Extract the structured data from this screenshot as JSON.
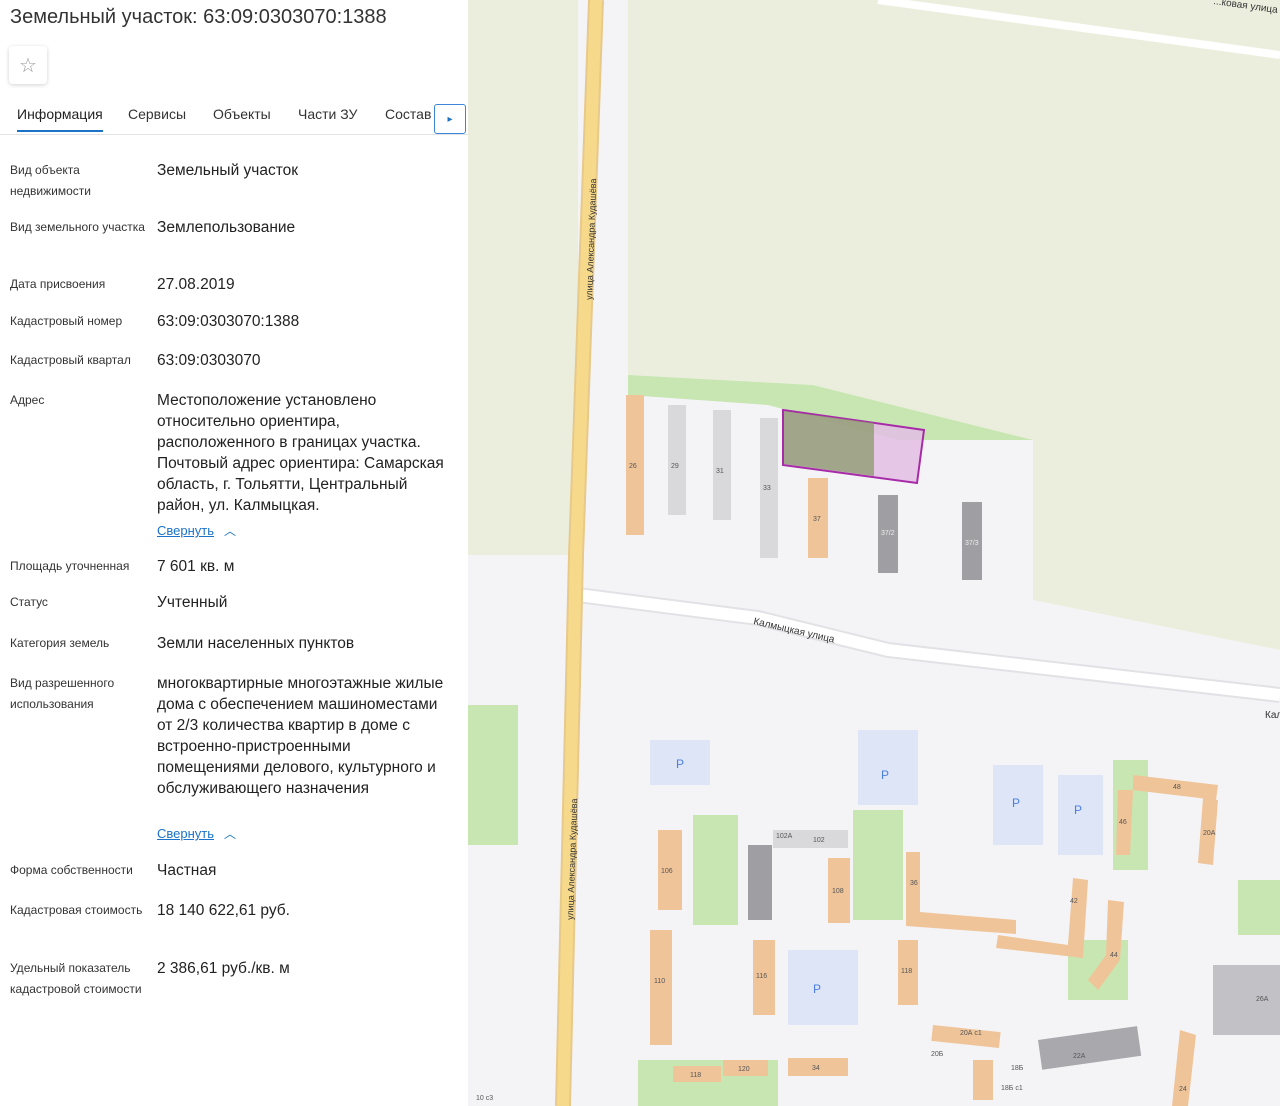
{
  "title": "Земельный участок: 63:09:0303070:1388",
  "favorite_icon": "star-outline-icon",
  "tabs": [
    "Информация",
    "Сервисы",
    "Объекты",
    "Части ЗУ",
    "Состав"
  ],
  "tab_next_icon": "chevron-right-icon",
  "fields": [
    {
      "label": "Вид объекта недвижимости",
      "value": "Земельный участок"
    },
    {
      "label": "Вид земельного участка",
      "value": "Землепользование"
    },
    {
      "label": "Дата присвоения",
      "value": "27.08.2019"
    },
    {
      "label": "Кадастровый номер",
      "value": "63:09:0303070:1388"
    },
    {
      "label": "Кадастровый квартал",
      "value": "63:09:0303070"
    },
    {
      "label": "Адрес",
      "value": "Местоположение установлено относительно ориентира, расположенного в границах участка. Почтовый адрес ориентира: Самарская область, г. Тольятти, Центральный район, ул. Калмыцкая."
    },
    {
      "label": "Площадь уточненная",
      "value": "7 601 кв. м"
    },
    {
      "label": "Статус",
      "value": "Учтенный"
    },
    {
      "label": "Категория земель",
      "value": "Земли населенных пунктов"
    },
    {
      "label": "Вид разрешенного использования",
      "value": "многоквартирные многоэтажные жилые дома с обеспечением машиноместами от 2/3 количества квартир в доме с встроенно-пристроенными помещениями делового, культурного и обслуживающего назначения"
    },
    {
      "label": "Форма собственности",
      "value": "Частная"
    },
    {
      "label": "Кадастровая стоимость",
      "value": "18 140 622,61 руб."
    },
    {
      "label": "Удельный показатель кадастровой стоимости",
      "value": "2 386,61 руб./кв. м"
    }
  ],
  "collapse_label": "Свернуть",
  "map": {
    "street_vertical_1": "улица Александра Кудашёва",
    "street_vertical_2": "улица Александра Кудашёва",
    "street_kalmytskaya": "Калмыцкая улица",
    "street_top": "...ковая улица",
    "street_right": "Кал",
    "parking": "P",
    "buildings_top": [
      "26",
      "29",
      "31",
      "33",
      "37",
      "37/2",
      "37/3"
    ],
    "buildings_bottom": [
      "102А",
      "102",
      "106",
      "108",
      "110",
      "116",
      "118",
      "118",
      "120",
      "34",
      "36",
      "42",
      "44",
      "46",
      "48",
      "20А",
      "20А с1",
      "20Б",
      "18Б",
      "18Б с1",
      "22А",
      "26А",
      "24",
      "10 с3"
    ],
    "colors": {
      "road": "#f7d98b",
      "green": "#c7e6b2",
      "field": "#eceedd",
      "building": "#f0c499",
      "plot_border": "#a72ba8",
      "plot_fill": "#e3bde4"
    }
  }
}
